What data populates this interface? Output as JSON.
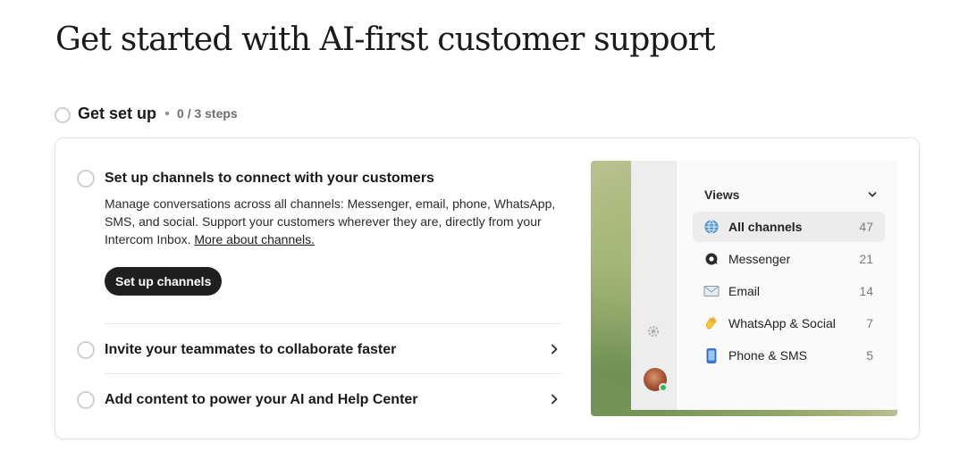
{
  "page": {
    "title": "Get started with AI-first customer support"
  },
  "section": {
    "title": "Get set up",
    "progress": "0 / 3 steps"
  },
  "steps": [
    {
      "title": "Set up channels to connect with your customers",
      "description": "Manage conversations across all channels: Messenger, email, phone, WhatsApp, SMS, and social. Support your customers wherever they are, directly from your Intercom Inbox.",
      "link": "More about channels.",
      "button": "Set up channels",
      "completed": false
    },
    {
      "title": "Invite your teammates to collaborate faster",
      "completed": false
    },
    {
      "title": "Add content to power your AI and Help Center",
      "completed": false
    }
  ],
  "illustration": {
    "views_title": "Views",
    "views": [
      {
        "label": "All channels",
        "count": "47",
        "icon": "globe-icon",
        "active": true
      },
      {
        "label": "Messenger",
        "count": "21",
        "icon": "messenger-icon",
        "active": false
      },
      {
        "label": "Email",
        "count": "14",
        "icon": "envelope-icon",
        "active": false
      },
      {
        "label": "WhatsApp & Social",
        "count": "7",
        "icon": "waving-hand-icon",
        "active": false
      },
      {
        "label": "Phone & SMS",
        "count": "5",
        "icon": "mobile-phone-icon",
        "active": false
      }
    ]
  },
  "colors": {
    "button_bg": "#1f1f1f",
    "online_status": "#2fb855"
  }
}
